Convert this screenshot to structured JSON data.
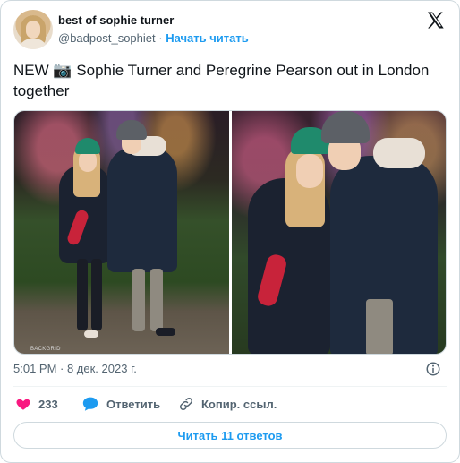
{
  "author": {
    "display_name": "best of sophie turner",
    "handle": "@badpost_sophiet",
    "separator": "·",
    "follow_label": "Начать читать"
  },
  "tweet": {
    "text": "NEW 📷 Sophie Turner and Peregrine Pearson out in London together",
    "timestamp": "5:01 PM · 8 дек. 2023 г.",
    "photo_watermark": "BACKGRID"
  },
  "actions": {
    "likes_count": "233",
    "reply_label": "Ответить",
    "copy_link_label": "Копир. ссыл."
  },
  "replies_button": {
    "label": "Читать 11 ответов"
  },
  "icons": {
    "logo": "x-logo-icon",
    "like": "heart-icon",
    "reply": "speech-bubble-icon",
    "copy": "link-icon",
    "info": "info-icon"
  },
  "colors": {
    "accent": "#1d9bf0",
    "like": "#f91880",
    "text_primary": "#0f1419",
    "text_secondary": "#536471",
    "border": "#cfd9de"
  }
}
